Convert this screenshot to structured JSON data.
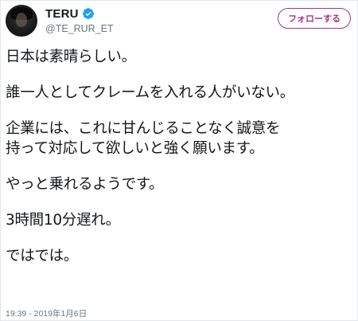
{
  "tweet": {
    "display_name": "TERU",
    "handle": "@TE_RUR_ET",
    "verified": true,
    "follow_label": "フォローする",
    "accent_color": "#a8347f",
    "verified_color": "#1da1f2",
    "lines": [
      "日本は素晴らしい。",
      "誰一人としてクレームを入れる人がいない。",
      "企業には、これに甘んじることなく誠意を",
      "持って対応して欲しいと強く願います。",
      "やっと乗れるようです。",
      "3時間10分遅れ。",
      "ではでは。"
    ],
    "timestamp": "19:39 - 2019年1月6日"
  },
  "icons": {
    "verified": "verified-badge-icon",
    "avatar": "profile-avatar"
  }
}
